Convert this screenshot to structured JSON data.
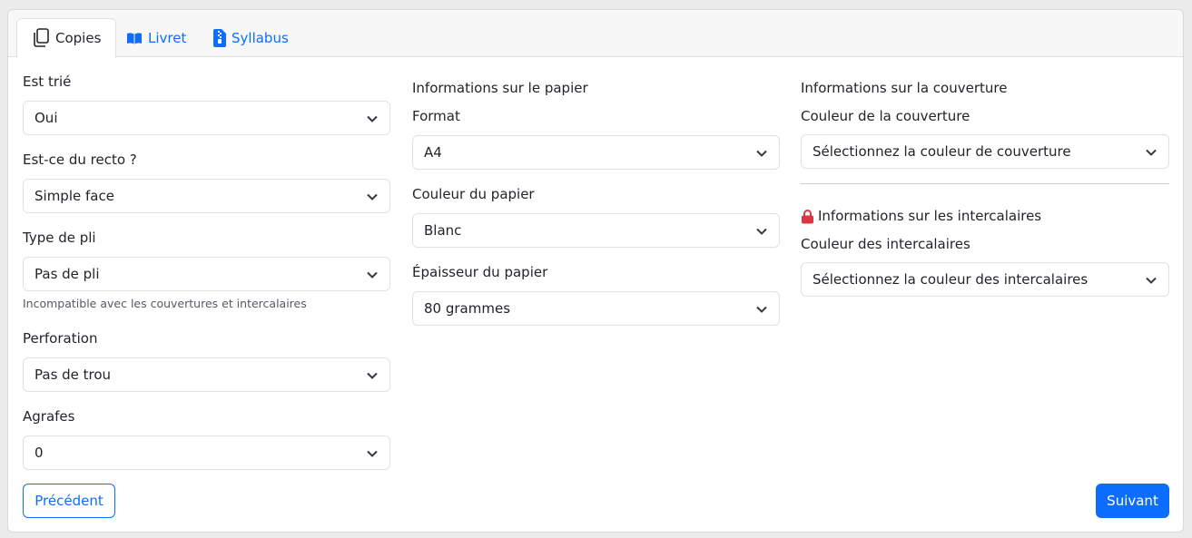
{
  "tabs": [
    {
      "label": "Copies",
      "icon": "copies-icon",
      "active": true
    },
    {
      "label": "Livret",
      "icon": "book-icon",
      "active": false
    },
    {
      "label": "Syllabus",
      "icon": "zip-file-icon",
      "active": false
    }
  ],
  "col1": {
    "sorted": {
      "label": "Est trié",
      "value": "Oui"
    },
    "recto": {
      "label": "Est-ce du recto ?",
      "value": "Simple face"
    },
    "fold": {
      "label": "Type de pli",
      "value": "Pas de pli",
      "help": "Incompatible avec les couvertures et intercalaires"
    },
    "perforation": {
      "label": "Perforation",
      "value": "Pas de trou"
    },
    "staples": {
      "label": "Agrafes",
      "value": "0"
    }
  },
  "col2": {
    "heading": "Informations sur le papier",
    "format": {
      "label": "Format",
      "value": "A4"
    },
    "color": {
      "label": "Couleur du papier",
      "value": "Blanc"
    },
    "thickness": {
      "label": "Épaisseur du papier",
      "value": "80 grammes"
    }
  },
  "col3": {
    "cover_heading": "Informations sur la couverture",
    "cover_color": {
      "label": "Couleur de la couverture",
      "value": "Sélectionnez la couleur de couverture"
    },
    "inserts_heading": "Informations sur les intercalaires",
    "inserts_color": {
      "label": "Couleur des intercalaires",
      "value": "Sélectionnez la couleur des intercalaires"
    }
  },
  "buttons": {
    "previous": "Précédent",
    "next": "Suivant"
  },
  "colors": {
    "accent": "#0d6efd",
    "lock": "#dc3545"
  }
}
